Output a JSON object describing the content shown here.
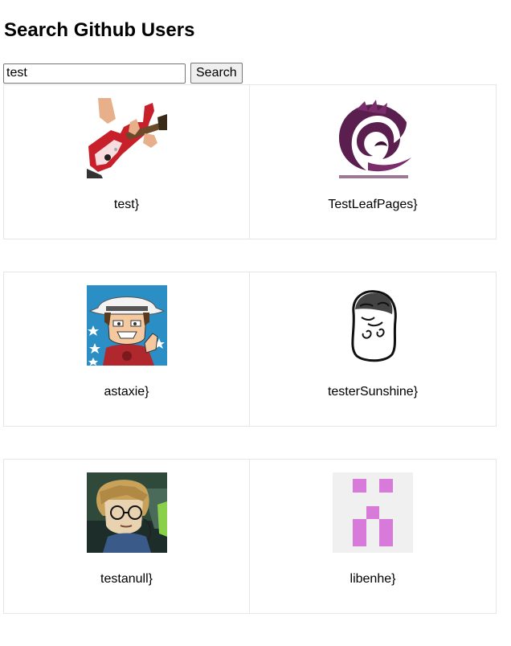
{
  "header": {
    "title": "Search Github Users"
  },
  "search": {
    "value": "test",
    "button_label": "Search"
  },
  "users": [
    {
      "login": "test}",
      "avatar_icon": "guitar-player-avatar"
    },
    {
      "login": "TestLeafPages}",
      "avatar_icon": "purple-bird-logo-avatar"
    },
    {
      "login": "astaxie}",
      "avatar_icon": "cartoon-man-hat-thumbs-up-avatar"
    },
    {
      "login": "testerSunshine}",
      "avatar_icon": "meme-face-avatar"
    },
    {
      "login": "testanull}",
      "avatar_icon": "anime-character-glasses-avatar"
    },
    {
      "login": "libenhe}",
      "avatar_icon": "pink-identicon-avatar"
    }
  ],
  "colors": {
    "card_border": "#e6e6e6",
    "identicon": "#d77ad9",
    "identicon_bg": "#f0f0f0"
  }
}
